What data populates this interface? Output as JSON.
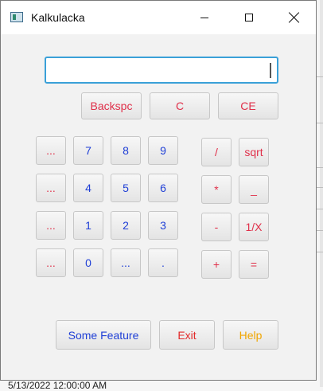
{
  "window": {
    "title": "Kalkulacka"
  },
  "display": {
    "value": ""
  },
  "top_row": [
    "Backspc",
    "C",
    "CE"
  ],
  "memory_buttons": [
    "...",
    "...",
    "...",
    "..."
  ],
  "digits": {
    "row1": [
      "7",
      "8",
      "9"
    ],
    "row2": [
      "4",
      "5",
      "6"
    ],
    "row3": [
      "1",
      "2",
      "3"
    ],
    "row4": [
      "0",
      "...",
      "."
    ]
  },
  "operators": {
    "row1": [
      "/",
      "sqrt"
    ],
    "row2": [
      "*",
      "_"
    ],
    "row3": [
      "-",
      "1/X"
    ],
    "row4": [
      "+",
      "="
    ]
  },
  "bottom": {
    "feature": "Some Feature",
    "exit": "Exit",
    "help": "Help"
  },
  "background": {
    "status_text": "5/13/2022 12:00:00 AM"
  },
  "colors": {
    "red": "#e0304a",
    "blue": "#1f3fd6",
    "orange": "#f0a500",
    "focus": "#3aa0d8"
  }
}
